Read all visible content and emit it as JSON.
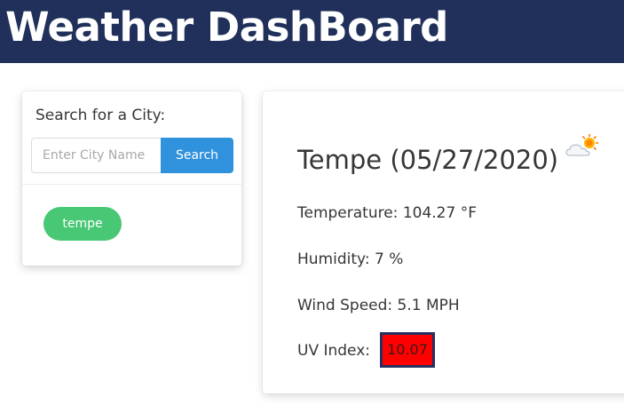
{
  "header": {
    "title": "Weather DashBoard",
    "background_color": "#20305a"
  },
  "search": {
    "title": "Search for a City:",
    "placeholder": "Enter City Name",
    "value": "",
    "button_label": "Search",
    "button_color": "#3092dd"
  },
  "history": {
    "items": [
      {
        "label": "tempe",
        "color": "#48c774"
      }
    ]
  },
  "current": {
    "city_title": "Tempe (05/27/2020)",
    "icon": "partly-cloudy-sun-icon",
    "temperature": "Temperature: 104.27 °F",
    "humidity": "Humidity: 7 %",
    "wind_speed": "Wind Speed: 5.1 MPH",
    "uv_label": "UV Index:",
    "uv_value": "10.07",
    "uv_color": "#ff0000"
  }
}
